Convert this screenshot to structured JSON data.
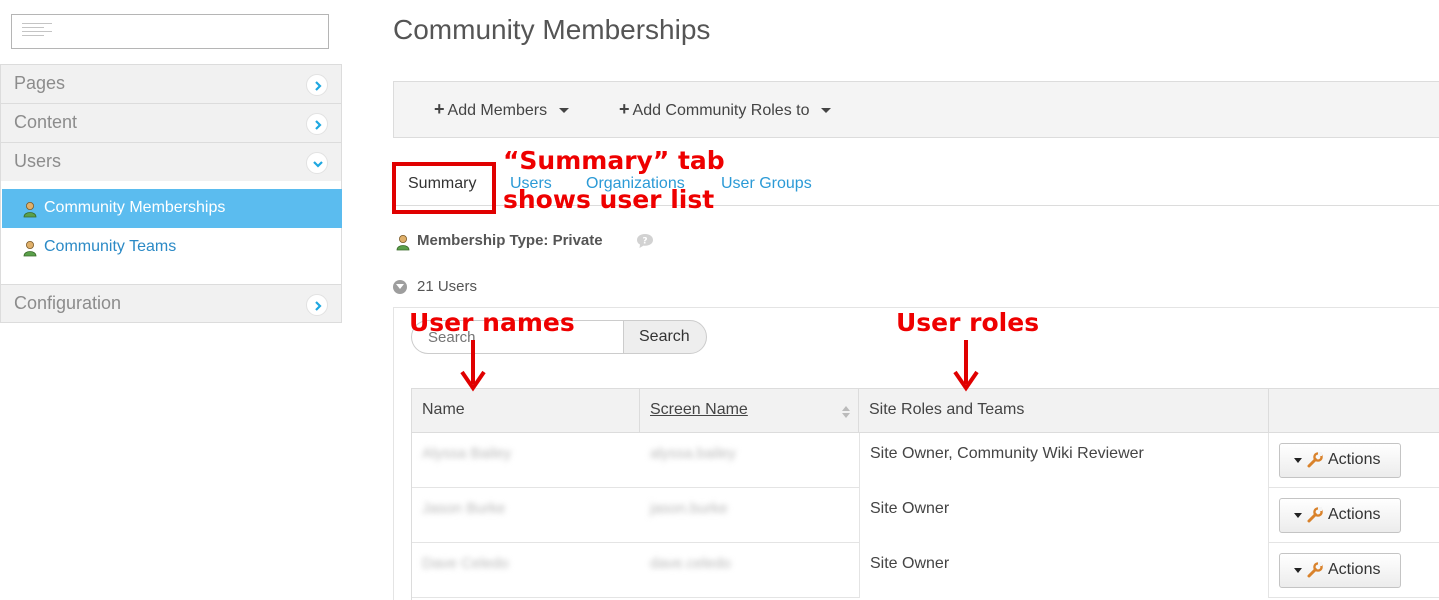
{
  "sidebar": {
    "sections": [
      {
        "label": "Pages",
        "state": "collapsed"
      },
      {
        "label": "Content",
        "state": "collapsed"
      },
      {
        "label": "Users",
        "state": "expanded"
      },
      {
        "label": "Configuration",
        "state": "collapsed"
      }
    ],
    "sub_items": [
      {
        "label": "Community Memberships",
        "active": true
      },
      {
        "label": "Community Teams",
        "active": false
      }
    ]
  },
  "page": {
    "title": "Community Memberships"
  },
  "toolbar": {
    "add_members": "Add Members",
    "add_roles": "Add Community Roles to"
  },
  "tabs": [
    {
      "label": "Summary",
      "active": true
    },
    {
      "label": "Users",
      "active": false
    },
    {
      "label": "Organizations",
      "active": false
    },
    {
      "label": "User Groups",
      "active": false
    }
  ],
  "membership": {
    "text": "Membership Type: Private"
  },
  "users": {
    "count_text": "21 Users"
  },
  "search": {
    "placeholder": "Search",
    "button_label": "Search"
  },
  "table": {
    "headers": [
      "Name",
      "Screen Name",
      "Site Roles and Teams",
      ""
    ],
    "rows": [
      {
        "name": "Alyssa Bailey",
        "screen_name": "alyssa.bailey",
        "roles": "Site Owner, Community Wiki Reviewer",
        "action": "Actions"
      },
      {
        "name": "Jason Burke",
        "screen_name": "jason.burke",
        "roles": "Site Owner",
        "action": "Actions"
      },
      {
        "name": "Dave Celedo",
        "screen_name": "dave.celedo",
        "roles": "Site Owner",
        "action": "Actions"
      }
    ]
  },
  "annotations": {
    "summary_note_line1": "“Summary” tab",
    "summary_note_line2": "shows user list",
    "names_note": "User names",
    "roles_note": "User roles",
    "color": "#ee0000"
  },
  "colors": {
    "active_nav": "#5bbcef",
    "link": "#2b9ad6",
    "chevron": "#1ea7e0"
  }
}
